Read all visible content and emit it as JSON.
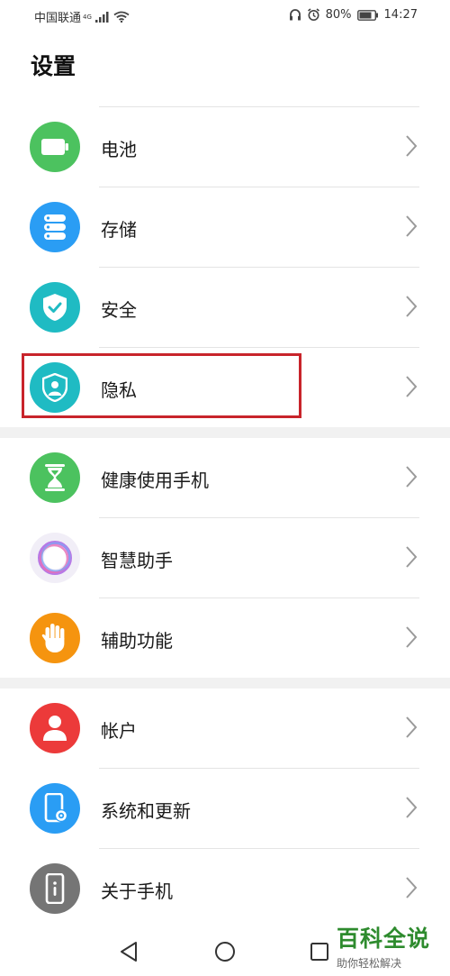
{
  "status_bar": {
    "carrier": "中国联通",
    "network": "4G",
    "battery_percent": "80%",
    "time": "14:27"
  },
  "page": {
    "title": "设置"
  },
  "groups": [
    {
      "items": [
        {
          "label": "电池",
          "icon": "battery-icon",
          "color": "#4cc25f"
        },
        {
          "label": "存储",
          "icon": "storage-icon",
          "color": "#2a9df4"
        },
        {
          "label": "安全",
          "icon": "shield-check-icon",
          "color": "#1fbbc3"
        },
        {
          "label": "隐私",
          "icon": "privacy-shield-icon",
          "color": "#1fbbc3"
        }
      ]
    },
    {
      "items": [
        {
          "label": "健康使用手机",
          "icon": "hourglass-icon",
          "color": "#4cc25f"
        },
        {
          "label": "智慧助手",
          "icon": "assistant-orb-icon",
          "color": "#c58fe8"
        },
        {
          "label": "辅助功能",
          "icon": "hand-icon",
          "color": "#f5940f"
        }
      ]
    },
    {
      "items": [
        {
          "label": "帐户",
          "icon": "person-icon",
          "color": "#ec3a3a"
        },
        {
          "label": "系统和更新",
          "icon": "phone-gear-icon",
          "color": "#2a9df4"
        },
        {
          "label": "关于手机",
          "icon": "phone-info-icon",
          "color": "#757575"
        }
      ]
    }
  ],
  "highlight_color": "#c8242b",
  "watermark": {
    "title": "百科全说",
    "subtitle": "助你轻松解决"
  }
}
